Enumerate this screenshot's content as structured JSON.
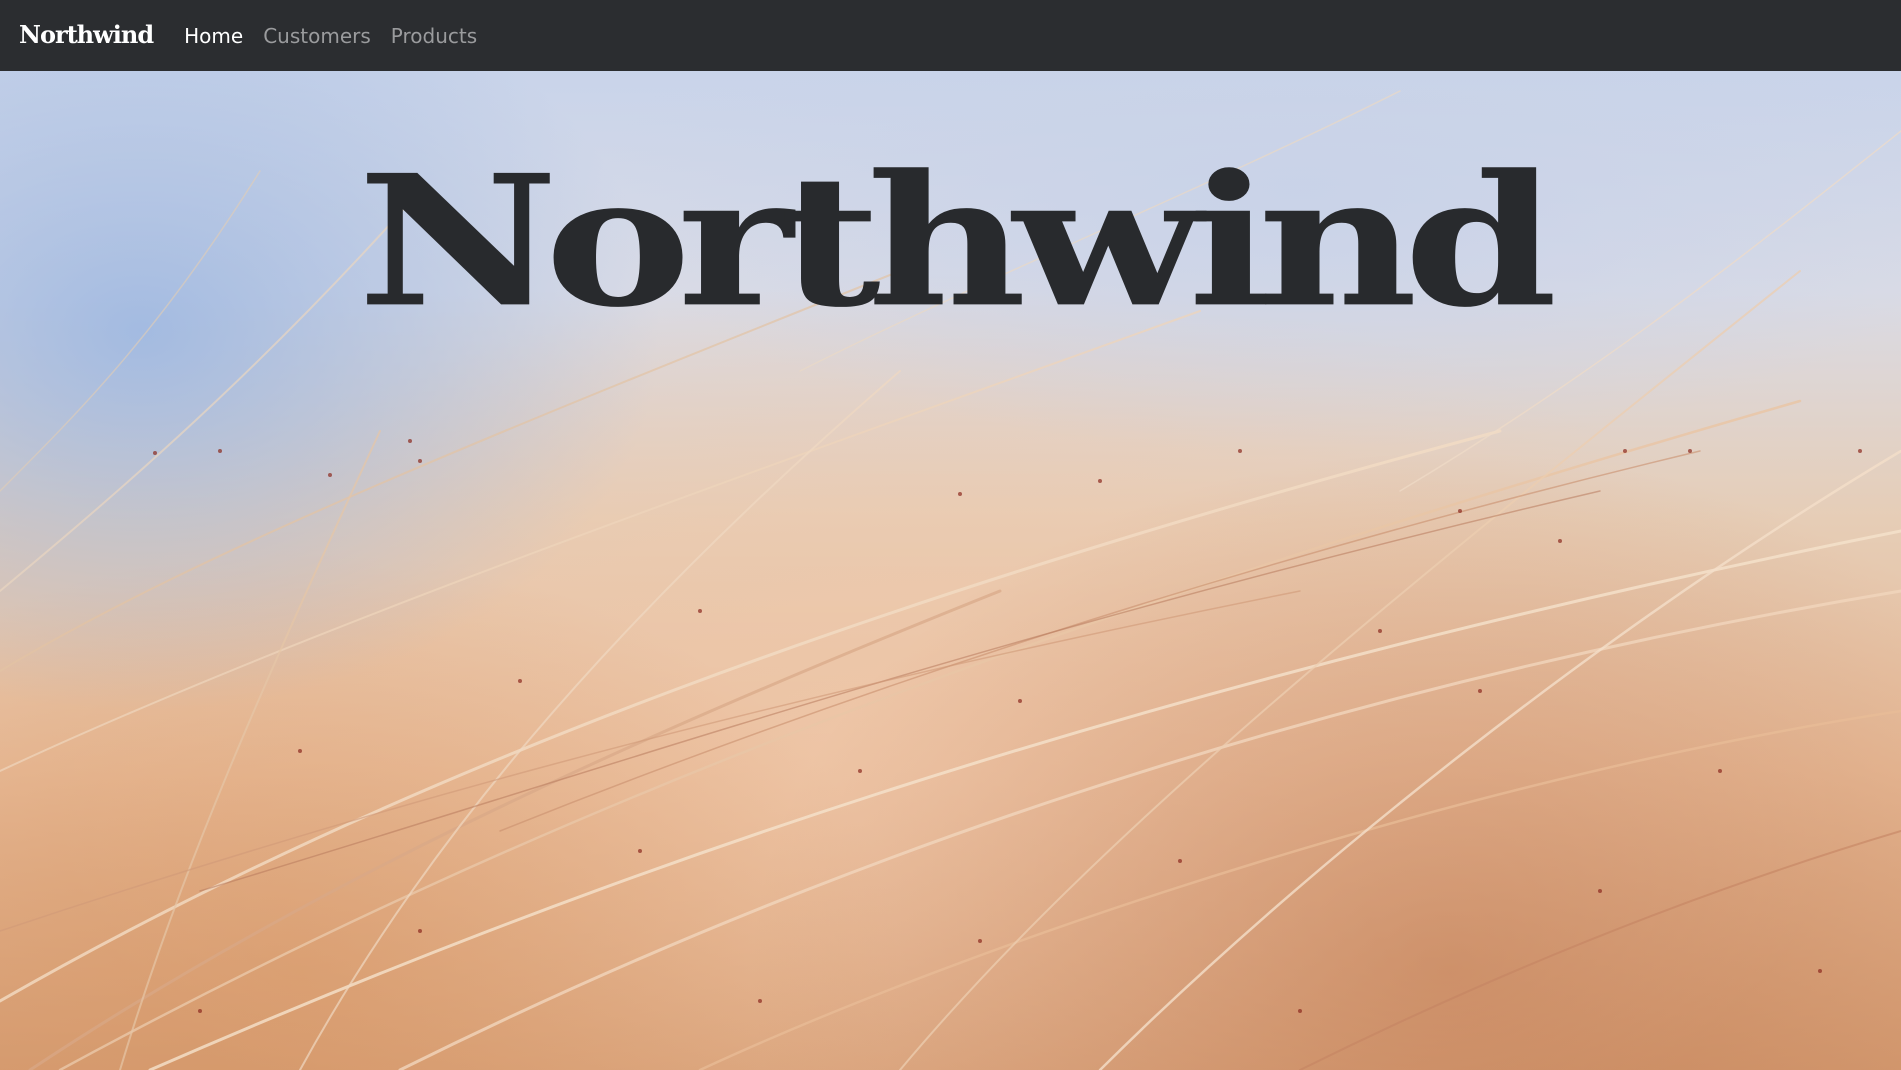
{
  "navbar": {
    "brand": "Northwind",
    "links": [
      {
        "label": "Home",
        "active": true
      },
      {
        "label": "Customers",
        "active": false
      },
      {
        "label": "Products",
        "active": false
      }
    ]
  },
  "hero": {
    "title": "Northwind",
    "background": "grass-field-photo"
  },
  "colors": {
    "navbar_bg": "#2b2d30",
    "title_color": "#282a2d",
    "nav_active": "#ffffff",
    "nav_inactive": "#9a9b9d"
  }
}
